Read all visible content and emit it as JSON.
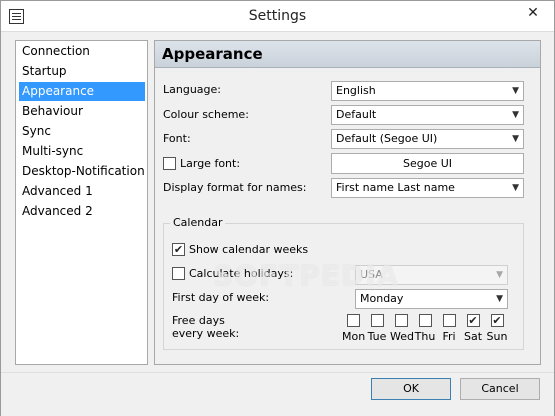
{
  "window": {
    "title": "Settings",
    "close_glyph": "✕",
    "icon": "list-icon"
  },
  "nav": {
    "items": [
      {
        "label": "Connection",
        "selected": false
      },
      {
        "label": "Startup",
        "selected": false
      },
      {
        "label": "Appearance",
        "selected": true
      },
      {
        "label": "Behaviour",
        "selected": false
      },
      {
        "label": "Sync",
        "selected": false
      },
      {
        "label": "Multi-sync",
        "selected": false
      },
      {
        "label": "Desktop-Notification",
        "selected": false
      },
      {
        "label": "Advanced 1",
        "selected": false
      },
      {
        "label": "Advanced 2",
        "selected": false
      }
    ]
  },
  "panel": {
    "title": "Appearance",
    "language": {
      "label": "Language:",
      "value": "English"
    },
    "colour_scheme": {
      "label": "Colour scheme:",
      "value": "Default"
    },
    "font": {
      "label": "Font:",
      "value": "Default (Segoe UI)"
    },
    "large_font": {
      "label": "Large font:",
      "checked": false,
      "button_label": "Segoe UI"
    },
    "name_format": {
      "label": "Display format for names:",
      "value": "First name Last name"
    }
  },
  "calendar": {
    "title": "Calendar",
    "show_weeks": {
      "label": "Show calendar weeks",
      "checked": true
    },
    "holidays": {
      "label": "Calculate holidays:",
      "checked": false,
      "value": "USA"
    },
    "first_day": {
      "label": "First day of week:",
      "value": "Monday"
    },
    "free_days": {
      "label_line1": "Free days",
      "label_line2": "every week:",
      "days": [
        {
          "label": "Mon",
          "checked": false
        },
        {
          "label": "Tue",
          "checked": false
        },
        {
          "label": "Wed",
          "checked": false
        },
        {
          "label": "Thu",
          "checked": false
        },
        {
          "label": "Fri",
          "checked": false
        },
        {
          "label": "Sat",
          "checked": true
        },
        {
          "label": "Sun",
          "checked": true
        }
      ]
    }
  },
  "watermark": "SOFTPEDIA",
  "buttons": {
    "ok": "OK",
    "cancel": "Cancel"
  },
  "glyphs": {
    "check": "✔",
    "arrow": "▼"
  }
}
